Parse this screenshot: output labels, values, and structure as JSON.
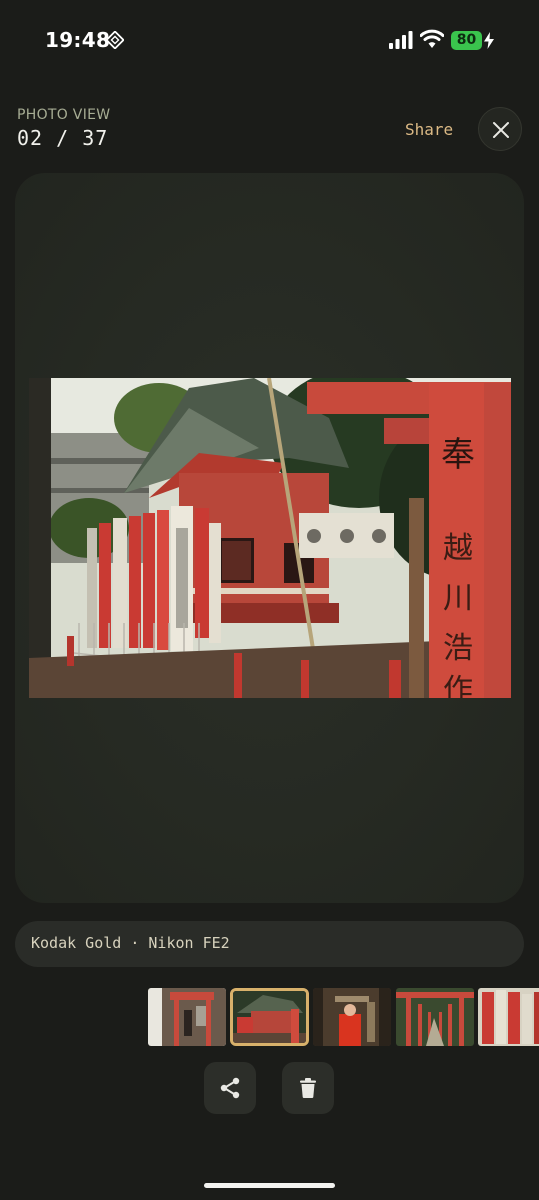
{
  "status": {
    "time": "19:48",
    "battery": "80"
  },
  "header": {
    "caption": "PHOTO VIEW",
    "counter": "02 / 37",
    "share_label": "Share"
  },
  "photo": {
    "subject": "shrine with red torii gates and banners",
    "torii_inscription": "奉 越 川 浩 作"
  },
  "info": {
    "film_camera": "Kodak Gold · Nikon FE2"
  },
  "thumbnails": {
    "selected_index": 1,
    "items": [
      {
        "name": "thumb-1"
      },
      {
        "name": "thumb-2"
      },
      {
        "name": "thumb-3"
      },
      {
        "name": "thumb-4"
      },
      {
        "name": "thumb-5"
      }
    ]
  },
  "actions": [
    {
      "icon": "share-icon"
    },
    {
      "icon": "trash-icon"
    }
  ],
  "colors": {
    "accent": "#dbb985",
    "selected_border": "#d8b16b",
    "background": "#1b1c19",
    "battery_green": "#3ac44d"
  }
}
